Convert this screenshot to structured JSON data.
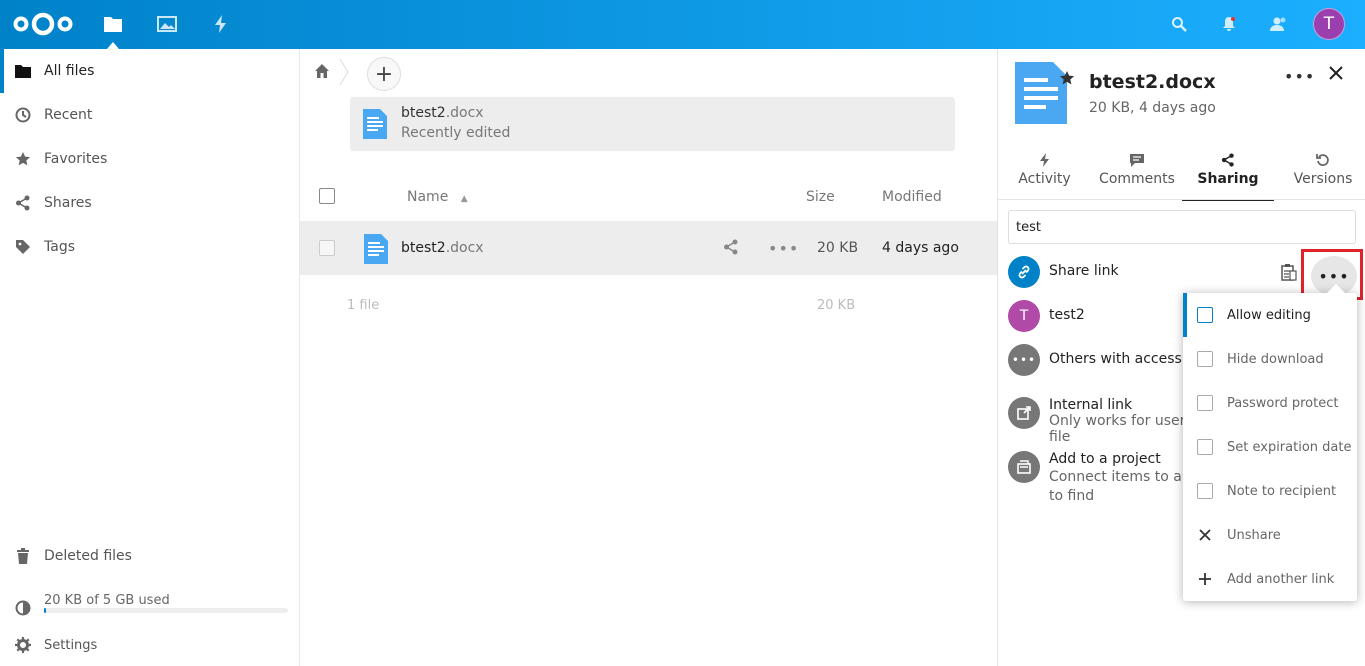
{
  "header": {
    "apps": [
      "files-icon",
      "photos-icon",
      "activity-icon"
    ],
    "right_icons": [
      "search-icon",
      "notifications-icon",
      "contacts-icon"
    ],
    "avatar_initial": "T",
    "brand_color": "#0082c9"
  },
  "nav": {
    "items": [
      {
        "label": "All files",
        "icon": "folder-icon"
      },
      {
        "label": "Recent",
        "icon": "clock-icon"
      },
      {
        "label": "Favorites",
        "icon": "star-icon"
      },
      {
        "label": "Shares",
        "icon": "share-icon"
      },
      {
        "label": "Tags",
        "icon": "tag-icon"
      }
    ],
    "deleted": "Deleted files",
    "quota": "20 KB of 5 GB used",
    "quota_fraction": 1e-05,
    "settings": "Settings"
  },
  "main": {
    "recent": {
      "name": "btest2",
      "ext": ".docx",
      "subtitle": "Recently edited"
    },
    "columns": {
      "name": "Name",
      "size": "Size",
      "modified": "Modified"
    },
    "files": [
      {
        "name": "btest2",
        "ext": ".docx",
        "size": "20 KB",
        "modified": "4 days ago"
      }
    ],
    "summary": {
      "count": "1 file",
      "size": "20 KB"
    }
  },
  "sidebar": {
    "title": "btest2.docx",
    "subtitle": "20 KB, 4 days ago",
    "tabs": [
      {
        "label": "Activity",
        "icon": "activity-icon"
      },
      {
        "label": "Comments",
        "icon": "comment-icon"
      },
      {
        "label": "Sharing",
        "icon": "share-icon"
      },
      {
        "label": "Versions",
        "icon": "history-icon"
      }
    ],
    "share_input_value": "test",
    "share_link": "Share link",
    "share_user": "test2",
    "share_user_initial": "T",
    "others": "Others with access",
    "internal_link": "Internal link",
    "internal_link_desc_1": "Only works for users w",
    "internal_link_desc_2": "file",
    "project": "Add to a project",
    "project_desc_1": "Connect items to a pr",
    "project_desc_2": "to find"
  },
  "menu": {
    "items": [
      {
        "label": "Allow editing",
        "type": "checkbox"
      },
      {
        "label": "Hide download",
        "type": "checkbox"
      },
      {
        "label": "Password protect",
        "type": "checkbox"
      },
      {
        "label": "Set expiration date",
        "type": "checkbox"
      },
      {
        "label": "Note to recipient",
        "type": "checkbox"
      },
      {
        "label": "Unshare",
        "type": "icon",
        "icon": "close-icon"
      },
      {
        "label": "Add another link",
        "type": "icon",
        "icon": "plus-icon"
      }
    ]
  }
}
